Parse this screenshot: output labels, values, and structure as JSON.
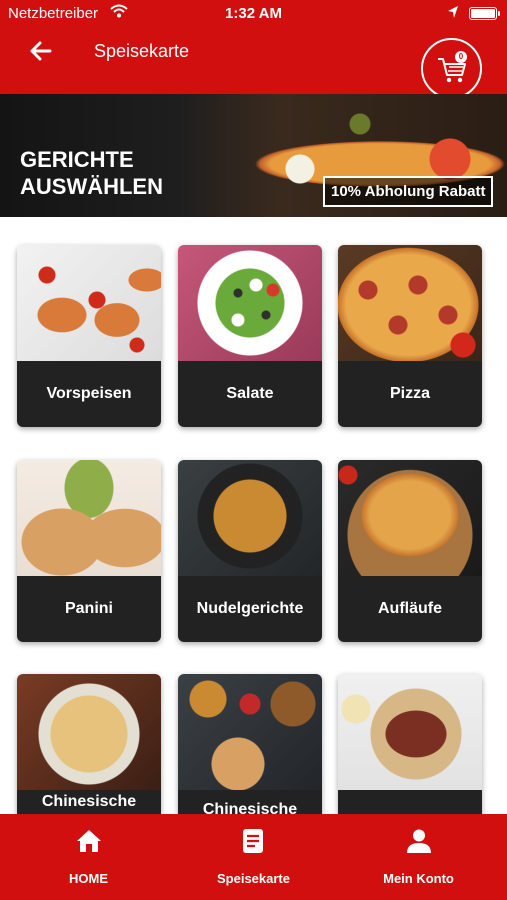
{
  "status_bar": {
    "carrier": "Netzbetreiber",
    "time": "1:32 AM"
  },
  "header": {
    "title": "Speisekarte",
    "cart_count": "0"
  },
  "banner": {
    "title": "GERICHTE\nAUSWÄHLEN",
    "badge": "10% Abholung Rabatt"
  },
  "categories": [
    {
      "label": "Vorspeisen"
    },
    {
      "label": "Salate"
    },
    {
      "label": "Pizza"
    },
    {
      "label": "Panini"
    },
    {
      "label": "Nudelgerichte"
    },
    {
      "label": "Aufläufe"
    },
    {
      "label": "Chinesische"
    },
    {
      "label": "Chinesische"
    },
    {
      "label": ""
    }
  ],
  "bottom_nav": [
    {
      "label": "HOME",
      "icon": "home-icon"
    },
    {
      "label": "Speisekarte",
      "icon": "menu-list-icon"
    },
    {
      "label": "Mein Konto",
      "icon": "user-icon"
    }
  ],
  "colors": {
    "primary": "#d10f0f",
    "card_label_bg": "#222222",
    "text_light": "#ffffff"
  }
}
